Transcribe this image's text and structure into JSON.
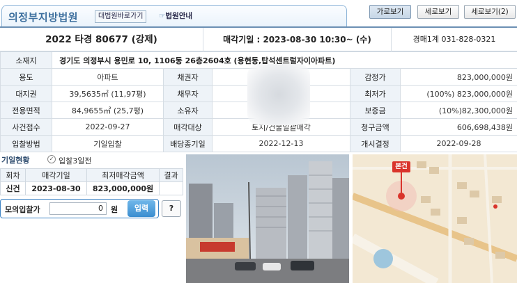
{
  "header": {
    "court_name": "의정부지방법원",
    "link_court": "대법원바로가기",
    "link_guide": "법원안내",
    "views": [
      "가로보기",
      "세로보기",
      "세로보기(2)"
    ]
  },
  "summary": {
    "case_no": "2022 타경 80677 (강제)",
    "sale_date": "매각기일 : 2023-08-30 10:30~ (수)",
    "dept": "경매1계 031-828-0321"
  },
  "info": {
    "location_label": "소재지",
    "location_value": "경기도 의정부시 용민로 10, 1106동 26층2604호 (용현동,탑석센트럴자이아파트)",
    "usage_label": "용도",
    "usage_value": "아파트",
    "creditor_label": "채권자",
    "creditor_value": "",
    "appraisal_label": "감정가",
    "appraisal_value": "823,000,000원",
    "land_label": "대지권",
    "land_value": "39,5635㎡ (11,97평)",
    "debtor_label": "채무자",
    "debtor_value": "",
    "min_label": "최저가",
    "min_value": "(100%) 823,000,000원",
    "area_label": "전용면적",
    "area_value": "84,9655㎡ (25,7평)",
    "owner_label": "소유자",
    "owner_value": "",
    "deposit_label": "보증금",
    "deposit_value": "(10%)82,300,000원",
    "received_label": "사건접수",
    "received_value": "2022-09-27",
    "target_label": "매각대상",
    "target_value": "토지/건물일괄매각",
    "claim_label": "청구금액",
    "claim_value": "606,698,438원",
    "bid_method_label": "입찰방법",
    "bid_method_value": "기일입찰",
    "deadline_label": "배당종기일",
    "deadline_value": "2022-12-13",
    "start_label": "개시결정",
    "start_value": "2022-09-28"
  },
  "history": {
    "title": "기일현황",
    "subtitle": "입찰3일전",
    "columns": [
      "회차",
      "매각기일",
      "최저매각금액",
      "결과"
    ],
    "rows": [
      {
        "round": "신건",
        "date": "2023-08-30",
        "price": "823,000,000원",
        "result": ""
      }
    ]
  },
  "mock_bid": {
    "label": "모의입찰가",
    "value": "0",
    "unit": "원",
    "enter_label": "입력",
    "help_label": "?"
  },
  "map": {
    "pin_label": "본건"
  }
}
